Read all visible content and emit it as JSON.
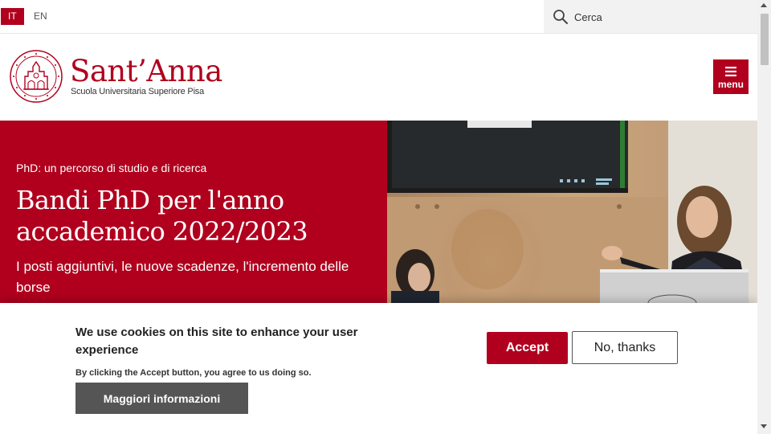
{
  "topbar": {
    "languages": [
      {
        "label": "IT",
        "active": true
      },
      {
        "label": "EN",
        "active": false
      }
    ],
    "search": {
      "placeholder": "Cerca",
      "value": "",
      "icon": "search-icon"
    }
  },
  "header": {
    "brand_name": "Sant’Anna",
    "brand_subtitle": "Scuola Universitaria Superiore Pisa",
    "menu_label": "menu",
    "menu_icon": "hamburger-icon"
  },
  "hero": {
    "kicker": "PhD: un percorso di studio e di ricerca",
    "title": "Bandi PhD per l'anno accademico 2022/2023",
    "subtitle": "I posti aggiuntivi, le nuove scadenze, l'incremento delle borse"
  },
  "cookie_banner": {
    "title": "We use cookies on this site to enhance your user experience",
    "note": "By clicking the Accept button, you agree to us doing so.",
    "more_info_label": "Maggiori informazioni",
    "accept_label": "Accept",
    "decline_label": "No, thanks"
  },
  "colors": {
    "brand_red": "#b0001e",
    "button_gray": "#555555",
    "search_bg": "#f2f2f2"
  }
}
